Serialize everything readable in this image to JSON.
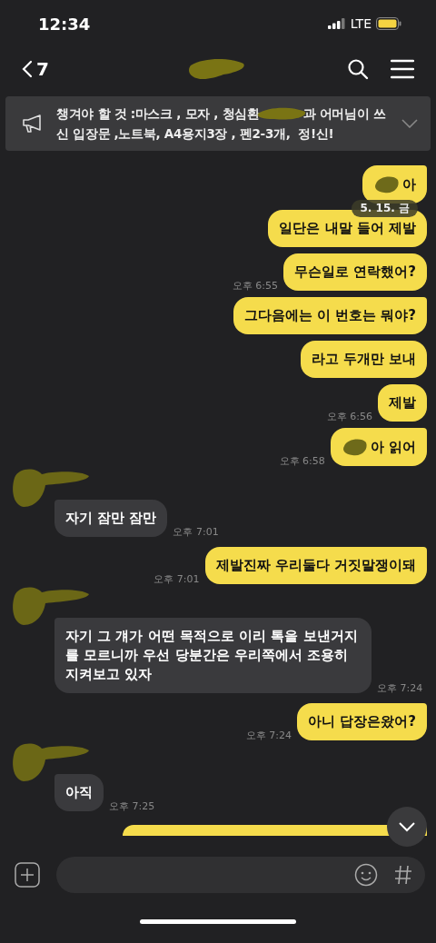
{
  "status_bar": {
    "time": "12:34",
    "network": "LTE"
  },
  "header": {
    "back_count": "7"
  },
  "notice": {
    "text_before": "챙겨야 할 것 :마스크 , 모자 , 청심환",
    "text_after": "과 어머님이 쓰",
    "second_line": "신 입장문 ,노트북, A4용지3장 , 펜2-3개,  정!신!"
  },
  "date_badge": "5. 15. 금",
  "messages": [
    {
      "kind": "sent",
      "redacted": true,
      "tail": true,
      "text": "아"
    },
    {
      "kind": "sent",
      "redacted": false,
      "tail": false,
      "text": "일단은 내말 들어 제발"
    },
    {
      "kind": "sent",
      "redacted": false,
      "tail": false,
      "text": "무슨일로 연락했어?",
      "time": "오후 6:55"
    },
    {
      "kind": "sent",
      "redacted": false,
      "tail": true,
      "text": "그다음에는 이 번호는 뭐야?"
    },
    {
      "kind": "sent",
      "redacted": false,
      "tail": false,
      "text": "라고 두개만 보내"
    },
    {
      "kind": "sent",
      "redacted": false,
      "tail": false,
      "text": "제발",
      "time": "오후 6:56"
    },
    {
      "kind": "sent",
      "redacted": true,
      "tail": true,
      "text": "아 읽어",
      "time": "오후 6:58"
    },
    {
      "kind": "received",
      "redacted": false,
      "tail": true,
      "text": "자기 잠만 잠만",
      "time": "오후 7:01"
    },
    {
      "kind": "sent",
      "redacted": false,
      "tail": true,
      "text": "제발진짜 우리둘다 거짓말쟁이돼",
      "time": "오후 7:01"
    },
    {
      "kind": "received",
      "redacted": false,
      "tail": true,
      "text": "자기 그 걔가 어떤 목적으로 이리 톡을 보낸거지를 모르니까 우선 당분간은 우리쪽에서 조용히 지켜보고 있자",
      "time": "오후 7:24"
    },
    {
      "kind": "sent",
      "redacted": false,
      "tail": true,
      "text": "아니 답장은왔어?",
      "time": "오후 7:24"
    },
    {
      "kind": "received",
      "redacted": false,
      "tail": true,
      "text": "아직",
      "time": "오후 7:25"
    },
    {
      "kind": "clipped"
    }
  ]
}
